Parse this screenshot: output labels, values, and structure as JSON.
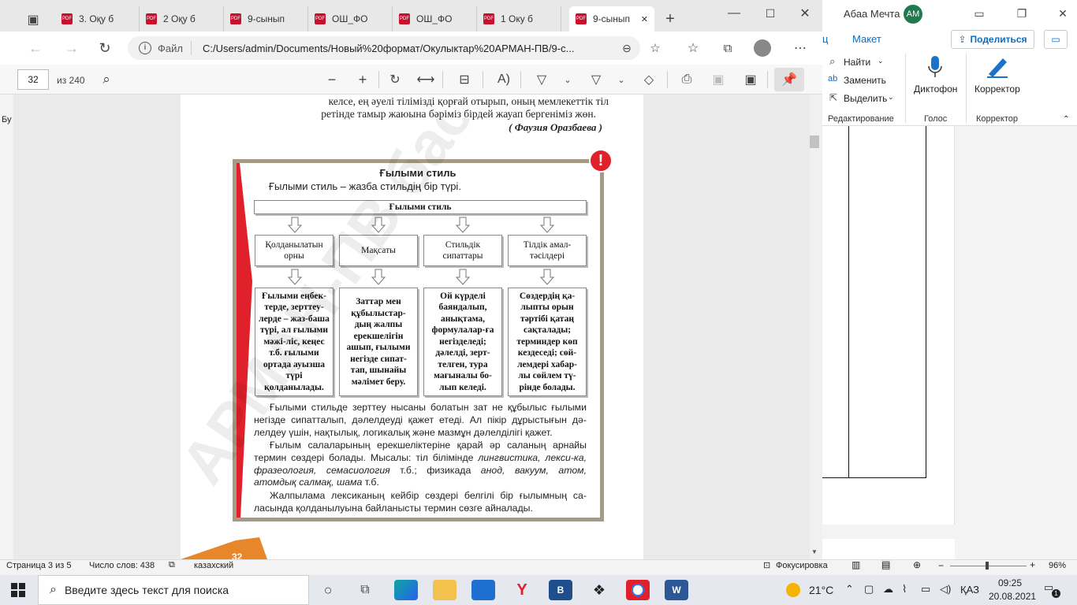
{
  "browser": {
    "tabs": [
      {
        "label": "3. Оқу б"
      },
      {
        "label": "2 Оқу б"
      },
      {
        "label": "9-сынып"
      },
      {
        "label": "ОШ_ФО"
      },
      {
        "label": "ОШ_ФО"
      },
      {
        "label": "1 Оку б"
      },
      {
        "label": "9-сынып",
        "active": true
      }
    ],
    "new_tab": "+",
    "address": {
      "scheme_label": "Файл",
      "url": "C:/Users/admin/Documents/Новый%20формат/Окулыктар%20АРМАН-ПВ/9-с..."
    },
    "pdf_toolbar": {
      "page_value": "32",
      "page_total": "из 240"
    }
  },
  "word": {
    "user_name": "Абаа Мечта",
    "avatar": "AM",
    "tabs": {
      "partial": "ц",
      "layout": "Макет",
      "share": "Поделиться"
    },
    "ribbon": {
      "find": "Найти",
      "replace": "Заменить",
      "select": "Выделить",
      "group_edit": "Редактирование",
      "dictophone": "Диктофон",
      "group_voice": "Голос",
      "corrector": "Корректор",
      "group_corrector": "Корректор"
    },
    "left_partial": "Бу",
    "status": {
      "page": "Страница 3 из 5",
      "words": "Число слов: 438",
      "language": "казахский",
      "focus": "Фокусировка",
      "zoom": "96%"
    }
  },
  "pdf_page": {
    "top_line1": "келсе, ең әуелі тілімізді қорғай отырып, оның мемлекеттік тіл",
    "top_line2": "ретінде тамыр жаюына бәріміз бірдей жауап бергеніміз жөн.",
    "author": "( Фаузия Оразбаева )",
    "box_title": "Ғылыми стиль",
    "box_subtitle": "Ғылыми стиль – жазба стильдің бір түрі.",
    "diagram_head": "Ғылыми стиль",
    "col_heads": [
      "Қолданылатын орны",
      "Мақсаты",
      "Стильдік сипаттары",
      "Тілдік амал-тәсілдері"
    ],
    "col_bodies": [
      "Ғылыми еңбек-терде, зерттеу-лерде – жаз-баша түрі, ал ғылыми мәжі-ліс, кеңес т.б. ғылыми ортада ауызша түрі қолданылады.",
      "Заттар мен құбылыстар-дың жалпы ерекшелігін ашып, ғылыми негізде сипат-тап, шынайы мәлімет беру.",
      "Ой күрделі баяндалып, анықтама, формулалар-ға негізделеді; дәлелді, зерт-телген, тура мағыналы бо-лып келеді.",
      "Сөздердің қа-лыпты орын тәртібі қатаң сақталады; терминдер көп кездеседі; сөй-лемдері хабар-лы сөйлем тү-рінде болады."
    ],
    "para1": "Ғылыми стильде зерттеу нысаны болатын зат не құбылыс ғылыми негізде сипатталып, дәлелдеуді қажет етеді. Ал пікір дұрыстығын дә-лелдеу үшін, нақтылық, логикалық және мазмұн дәлелділігі қажет.",
    "para2_a": "Ғылым салаларының ерекшеліктеріне қарай әр саланың арнайы термин сөздері болады. Мысалы: тіл білімінде ",
    "para2_i1": "лингвистика, лекси-ка, фразеология, семасиология",
    "para2_b": " т.б.; физикада ",
    "para2_i2": "анод, вакуум, атом, атомдық салмақ, шама",
    "para2_c": " т.б.",
    "para3": "Жалпылама лексиканың кейбір сөздері белгілі бір ғылымның са-ласында қолданылуына байланысты термин сөзге айналады.",
    "page_number": "32",
    "watermark": "АРМАН-ПВ баспасы"
  },
  "taskbar": {
    "search_placeholder": "Введите здесь текст для поиска",
    "weather": "21°C",
    "lang": "ҚАЗ",
    "time": "09:25",
    "date": "20.08.2021",
    "notifications": "1"
  },
  "colors": {
    "accent": "#0f6cbd",
    "frame": "#a59b85",
    "red": "#e0202a",
    "orange": "#e8862a"
  }
}
